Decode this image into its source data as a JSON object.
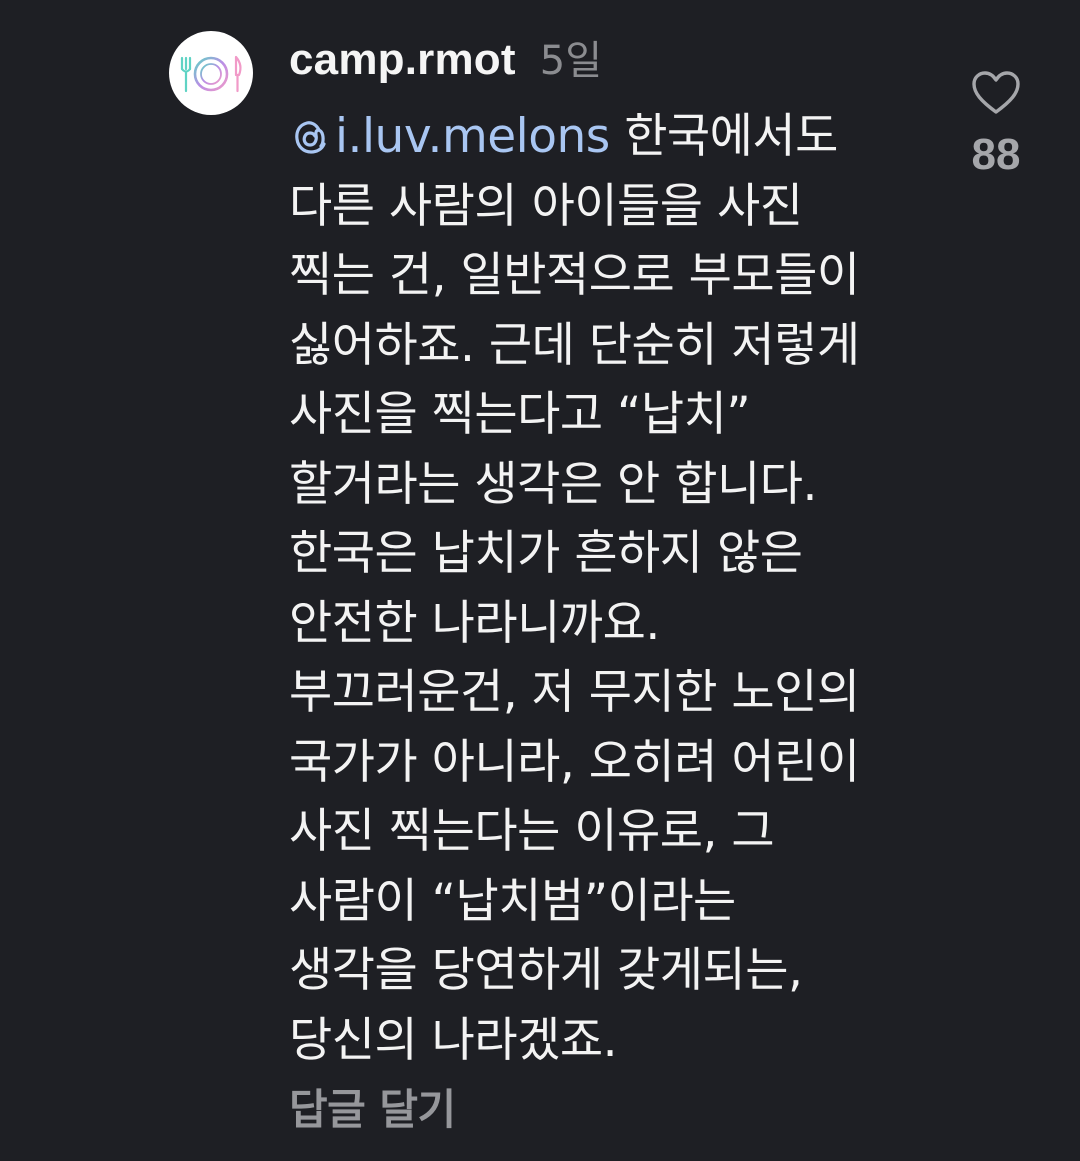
{
  "comment": {
    "author": "camp.rmot",
    "time": "5일",
    "avatar_icon": "plate-fork-knife-icon",
    "mention_icon": "threads-at-icon",
    "mention": "i.luv.melons",
    "lines": [
      " 한국에서도",
      "다른 사람의 아이들을 사진",
      "찍는 건, 일반적으로 부모들이",
      "싫어하죠. 근데 단순히 저렇게",
      "사진을 찍는다고 “납치”",
      "할거라는 생각은 안 합니다.",
      "한국은 납치가 흔하지 않은",
      "안전한 나라니까요.",
      "부끄러운건, 저 무지한 노인의",
      "국가가 아니라, 오히려 어린이",
      "사진 찍는다는 이유로, 그",
      "사람이 “납치범”이라는",
      "생각을 당연하게 갖게되는,",
      "당신의 나라겠죠."
    ],
    "reply_label": "답글 달기",
    "like_icon": "heart-outline-icon",
    "like_count": "88"
  },
  "colors": {
    "background": "#1e1f24",
    "text": "#f3f3f3",
    "muted": "#8b8c90",
    "mention": "#a9c6f2",
    "avatar_teal": "#5fd3c4",
    "avatar_pink": "#f19ac8",
    "avatar_purple": "#b98ee6"
  }
}
